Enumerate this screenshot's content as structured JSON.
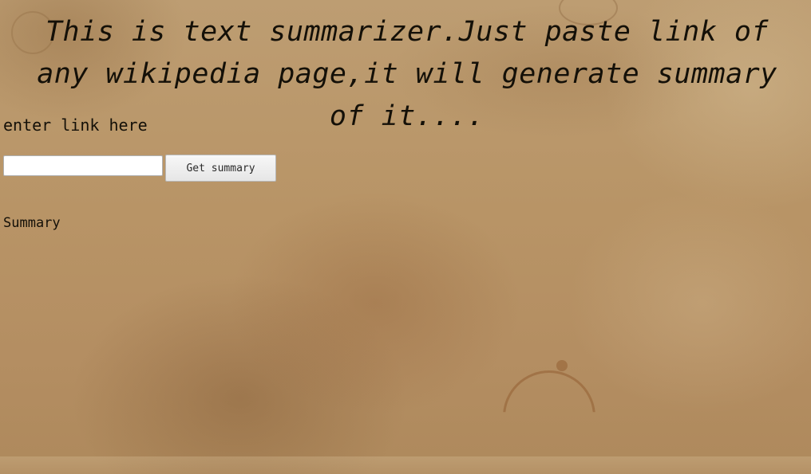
{
  "header": {
    "title": "This is text summarizer.Just paste link of any wikipedia page,it will generate summary of it...."
  },
  "form": {
    "link_label": "enter link here",
    "link_input_value": "",
    "link_input_placeholder": "",
    "submit_label": "Get summary"
  },
  "result": {
    "heading": "Summary",
    "text": ""
  }
}
